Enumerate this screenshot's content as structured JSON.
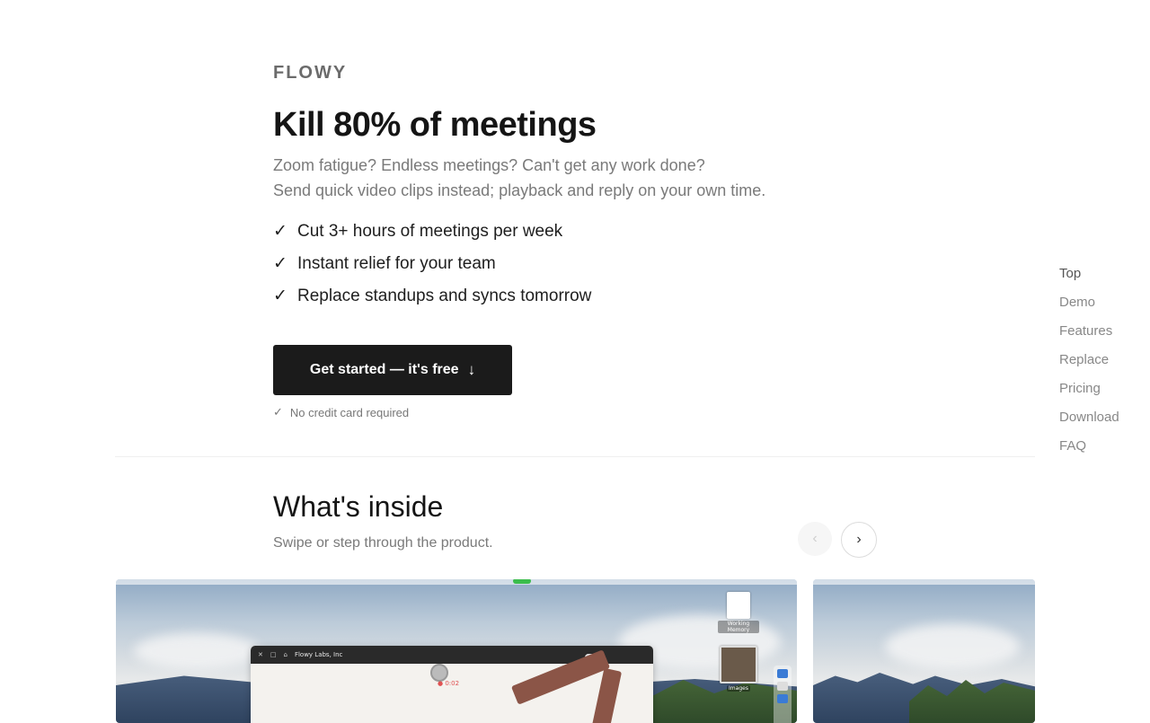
{
  "brand": {
    "logo": "FLOWY"
  },
  "hero": {
    "headline": "Kill 80% of meetings",
    "subtitle_line1": "Zoom fatigue? Endless meetings? Can't get any work done?",
    "subtitle_line2": "Send quick video clips instead; playback and reply on your own time.",
    "benefits": [
      "Cut 3+ hours of meetings per week",
      "Instant relief for your team",
      "Replace standups and syncs tomorrow"
    ],
    "check_glyph": "✓",
    "cta_label": "Get started — it's free",
    "cta_icon": "arrow-down-icon",
    "no_card": "No credit card required"
  },
  "whats_inside": {
    "title": "What's inside",
    "subtitle": "Swipe or step through the product.",
    "prev_glyph": "‹",
    "next_glyph": "›"
  },
  "slide": {
    "app_title": "Flowy Labs, Inc",
    "desk_item_1": "Working Memory",
    "desk_item_2": "Images",
    "rec_time": "0:02"
  },
  "section_nav": [
    "Top",
    "Demo",
    "Features",
    "Replace",
    "Pricing",
    "Download",
    "FAQ"
  ],
  "colors": {
    "cta_bg": "#1b1b1b",
    "muted_text": "#7a7a7a",
    "nav_text": "#888888"
  }
}
